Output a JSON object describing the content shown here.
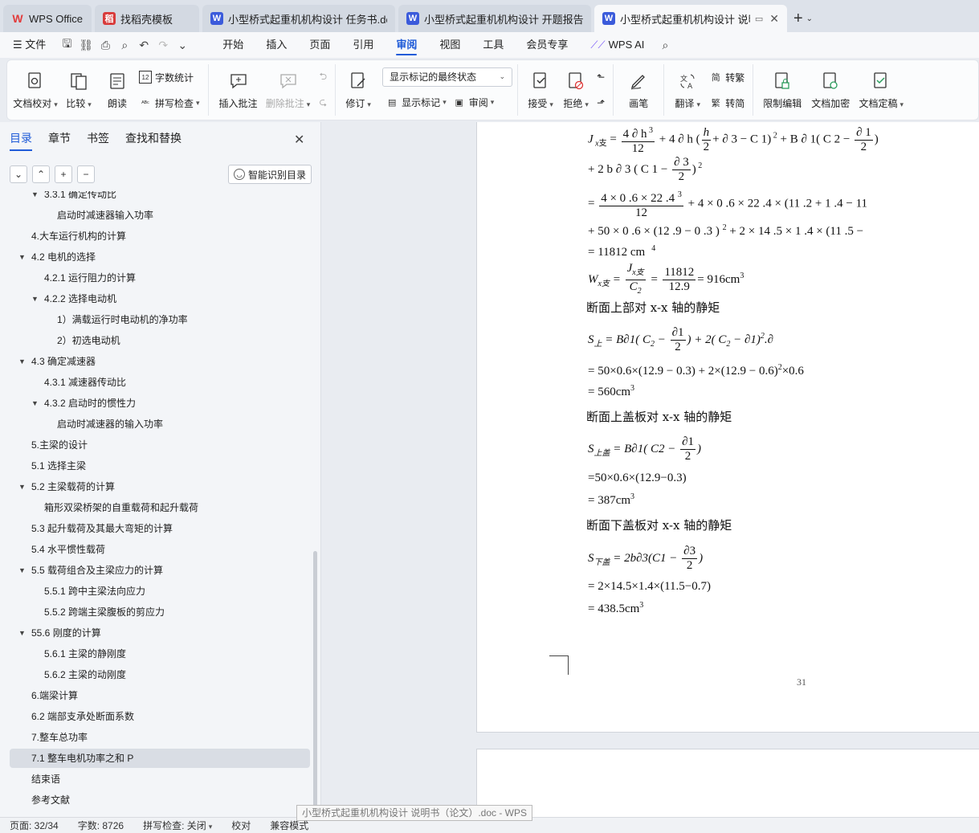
{
  "tabs": [
    {
      "label": "WPS Office",
      "icon": "wps-logo-icon",
      "color": "#e23c3c"
    },
    {
      "label": "找稻壳模板",
      "icon": "docer-icon",
      "color": "#d83b3b"
    },
    {
      "label": "小型桥式起重机机构设计 任务书.doc",
      "icon": "word-doc-icon",
      "color": "#3b5bdb"
    },
    {
      "label": "小型桥式起重机机构设计 开题报告.doc",
      "icon": "word-doc-icon",
      "color": "#3b5bdb"
    },
    {
      "label": "小型桥式起重机机构设计 说明",
      "icon": "word-doc-icon",
      "color": "#3b5bdb"
    }
  ],
  "menu": {
    "file": "文件",
    "items": [
      "开始",
      "插入",
      "页面",
      "引用",
      "审阅",
      "视图",
      "工具",
      "会员专享"
    ],
    "active": "审阅",
    "wps_ai": "WPS AI"
  },
  "ribbon": {
    "doc_check": "文档校对",
    "compare": "比较",
    "read_aloud": "朗读",
    "word_count": "字数统计",
    "spell_check": "拼写检查",
    "insert_comment": "插入批注",
    "delete_comment": "删除批注",
    "revise": "修订",
    "markup_state": "显示标记的最终状态",
    "show_markup": "显示标记",
    "review": "审阅",
    "accept": "接受",
    "reject": "拒绝",
    "pen": "画笔",
    "translate": "翻译",
    "to_traditional": "转繁",
    "to_simplified": "转简",
    "restrict_edit": "限制编辑",
    "encrypt": "文档加密",
    "finalize": "文档定稿"
  },
  "nav": {
    "tabs": [
      "目录",
      "章节",
      "书签",
      "查找和替换"
    ],
    "active_tab": "目录",
    "smart_toc": "智能识别目录",
    "toc": [
      {
        "label": "3.3.1 确定传动比",
        "level": 2,
        "expanded": true
      },
      {
        "label": "启动时减速器输入功率",
        "level": 3
      },
      {
        "label": "4.大车运行机构的计算",
        "level": 1
      },
      {
        "label": "4.2 电机的选择",
        "level": 1,
        "expanded": true
      },
      {
        "label": "4.2.1 运行阻力的计算",
        "level": 2
      },
      {
        "label": "4.2.2 选择电动机",
        "level": 2,
        "expanded": true
      },
      {
        "label": "1）满载运行时电动机的净功率",
        "level": 3
      },
      {
        "label": "2）初选电动机",
        "level": 3
      },
      {
        "label": "4.3 确定减速器",
        "level": 1,
        "expanded": true
      },
      {
        "label": "4.3.1 减速器传动比",
        "level": 2
      },
      {
        "label": "4.3.2 启动时的惯性力",
        "level": 2,
        "expanded": true
      },
      {
        "label": "启动时减速器的输入功率",
        "level": 3
      },
      {
        "label": "5.主梁的设计",
        "level": 1
      },
      {
        "label": "5.1 选择主梁",
        "level": 1
      },
      {
        "label": "5.2  主梁载荷的计算",
        "level": 1,
        "expanded": true
      },
      {
        "label": "箱形双梁桥架的自重载荷和起升载荷",
        "level": 2
      },
      {
        "label": "5.3 起升载荷及其最大弯矩的计算",
        "level": 1
      },
      {
        "label": "5.4 水平惯性载荷",
        "level": 1
      },
      {
        "label": "5.5  载荷组合及主梁应力的计算",
        "level": 1,
        "expanded": true
      },
      {
        "label": "5.5.1  跨中主梁法向应力",
        "level": 2
      },
      {
        "label": "5.5.2  跨端主梁腹板的剪应力",
        "level": 2
      },
      {
        "label": "55.6  刚度的计算",
        "level": 1,
        "expanded": true
      },
      {
        "label": "5.6.1 主梁的静刚度",
        "level": 2
      },
      {
        "label": "5.6.2  主梁的动刚度",
        "level": 2
      },
      {
        "label": "6.端梁计算",
        "level": 1
      },
      {
        "label": "6.2 端部支承处断面系数",
        "level": 1
      },
      {
        "label": "7.整车总功率",
        "level": 1
      },
      {
        "label": "7.1 整车电机功率之和 P",
        "level": 1,
        "selected": true
      },
      {
        "label": "结束语",
        "level": 1
      },
      {
        "label": "参考文献",
        "level": 1
      }
    ]
  },
  "document": {
    "heading_section": "断面上部对 x-x 轴的静矩",
    "heading_top_plate": "断面上盖板对 x-x 轴的静矩",
    "heading_bottom_plate": "断面下盖板对 x-x 轴的静矩",
    "eq_Jx_result": "= 11812    cm",
    "eq_Jx_result_exp": "4",
    "eq_Wx_value": "11812",
    "eq_Wx_den": "12.9",
    "eq_Wx_result": "= 916cm",
    "eq_S_line2": "= 50×0.6×(12.9 − 0.3) + 2×(12.9 − 0.6)",
    "eq_S_line2_tail": "×0.6",
    "eq_S_line3": "= 560cm",
    "eq_Stop_line2": "=50×0.6×(12.9−0.3)",
    "eq_Stop_line3": "= 387cm",
    "eq_Sbot_line2": "= 2×14.5×1.4×(11.5−0.7)",
    "eq_Sbot_line3": "= 438.5cm",
    "page_number": "31"
  },
  "statusbar": {
    "page": "页面: 32/34",
    "words": "字数: 8726",
    "spell": "拼写检查: 关闭",
    "proof": "校对",
    "compat": "兼容模式"
  },
  "tooltip": "小型桥式起重机机构设计 说明书（论文）.doc - WPS"
}
